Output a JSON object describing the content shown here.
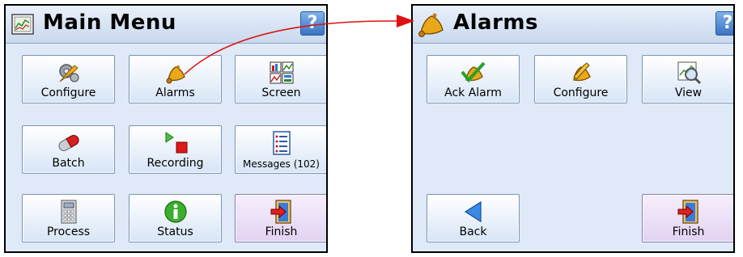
{
  "left_panel": {
    "title": "Main Menu",
    "help_label": "?",
    "buttons": [
      {
        "label": "Configure",
        "icon": "gears-wrench-icon"
      },
      {
        "label": "Alarms",
        "icon": "bell-icon"
      },
      {
        "label": "Screen",
        "icon": "screen-layout-icon"
      },
      {
        "label": "Batch",
        "icon": "capsule-icon"
      },
      {
        "label": "Recording",
        "icon": "play-record-icon"
      },
      {
        "label": "Messages (102)",
        "icon": "list-icon"
      },
      {
        "label": "Process",
        "icon": "calculator-icon"
      },
      {
        "label": "Status",
        "icon": "info-icon"
      },
      {
        "label": "Finish",
        "icon": "exit-door-icon"
      }
    ]
  },
  "right_panel": {
    "title": "Alarms",
    "help_label": "?",
    "buttons": [
      {
        "label": "Ack Alarm",
        "icon": "bell-check-icon"
      },
      {
        "label": "Configure",
        "icon": "bell-wrench-icon"
      },
      {
        "label": "View",
        "icon": "magnifier-chart-icon"
      },
      {
        "label": "Back",
        "icon": "back-arrow-icon"
      },
      {
        "label": "Finish",
        "icon": "exit-door-icon"
      }
    ]
  },
  "colors": {
    "panel_bg": "#dfe9f7",
    "finish_button": "#e2d3f2",
    "help_button": "#3a74c2",
    "connector_arrow": "#e01010"
  }
}
